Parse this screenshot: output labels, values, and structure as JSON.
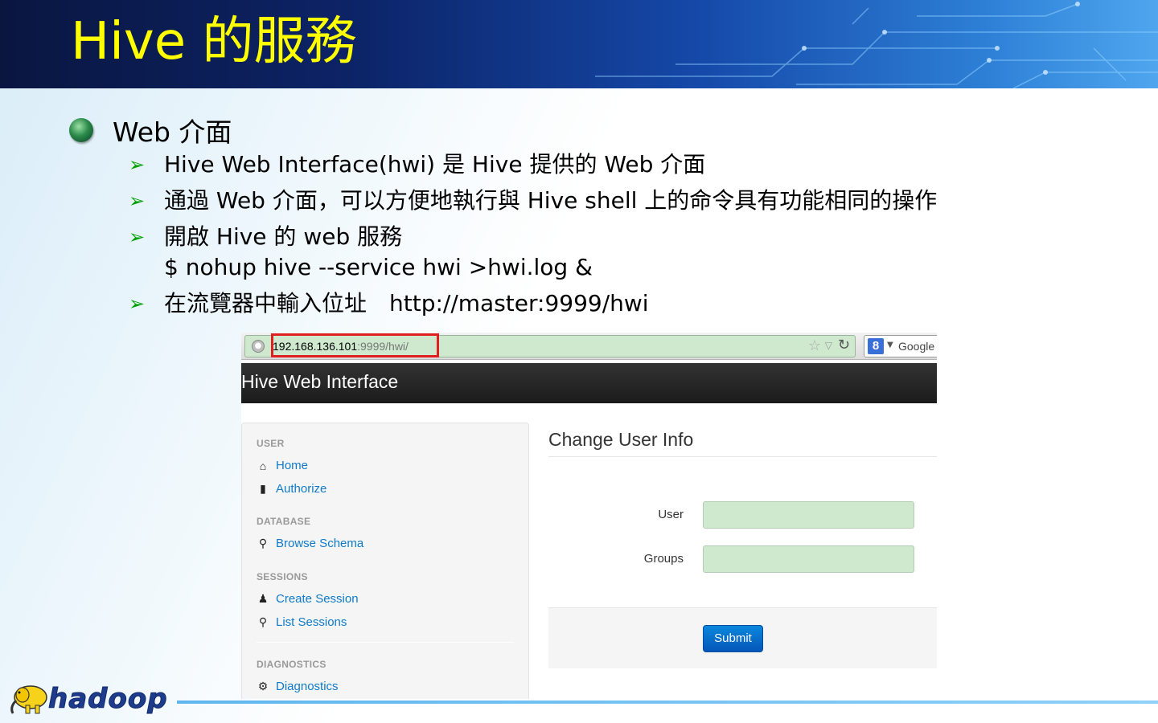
{
  "slide": {
    "title": "Hive 的服務",
    "bullet_main": "Web 介面",
    "sub_bullets": [
      "Hive Web Interface(hwi) 是 Hive 提供的 Web 介面",
      "通過 Web 介面，可以方便地執行與 Hive shell 上的命令具有功能相同的操作",
      "開啟 Hive 的 web 服務",
      "$ nohup hive --service hwi >hwi.log &",
      "在流覽器中輸入位址　http://master:9999/hwi"
    ],
    "arrow_glyph": "➢",
    "logo_text": "hadoop"
  },
  "browser": {
    "url_host": "192.168.136.101",
    "url_rest": ":9999/hwi/",
    "search_engine": "Google",
    "search_icon": "8"
  },
  "hwi": {
    "brand": "Hive Web Interface",
    "sidebar": {
      "sections": [
        {
          "header": "USER",
          "items": [
            {
              "label": "Home",
              "icon": "home-icon"
            },
            {
              "label": "Authorize",
              "icon": "lock-icon"
            }
          ]
        },
        {
          "header": "DATABASE",
          "items": [
            {
              "label": "Browse Schema",
              "icon": "search-icon"
            }
          ]
        },
        {
          "header": "SESSIONS",
          "items": [
            {
              "label": "Create Session",
              "icon": "user-icon"
            },
            {
              "label": "List Sessions",
              "icon": "search-icon"
            }
          ]
        },
        {
          "header": "DIAGNOSTICS",
          "items": [
            {
              "label": "Diagnostics",
              "icon": "gear-icon"
            }
          ]
        }
      ]
    },
    "form": {
      "title": "Change User Info",
      "user_label": "User",
      "user_value": "",
      "groups_label": "Groups",
      "groups_value": "",
      "submit_label": "Submit"
    }
  },
  "colors": {
    "title": "#ffff00",
    "arrow": "#00a000",
    "link": "#0f7bc8",
    "highlight_box": "#e02020",
    "input_fill": "#cfe9cf",
    "submit": "#0a6fcf"
  }
}
